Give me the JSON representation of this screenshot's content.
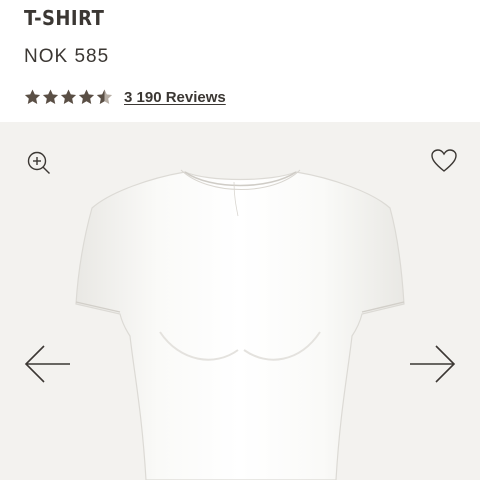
{
  "product": {
    "title": "T-SHIRT",
    "price": "NOK 585",
    "rating": 4.5,
    "rating_max": 5,
    "reviews_label": "3 190 Reviews"
  },
  "gallery": {
    "icons": {
      "zoom": "zoom-in-icon",
      "wishlist": "heart-icon",
      "previous": "arrow-left-icon",
      "next": "arrow-right-icon"
    }
  },
  "colors": {
    "text": "#3b3733",
    "star": "#5a4f45",
    "gallery_bg": "#f3f2ef",
    "garment": "#fbfbf9"
  }
}
